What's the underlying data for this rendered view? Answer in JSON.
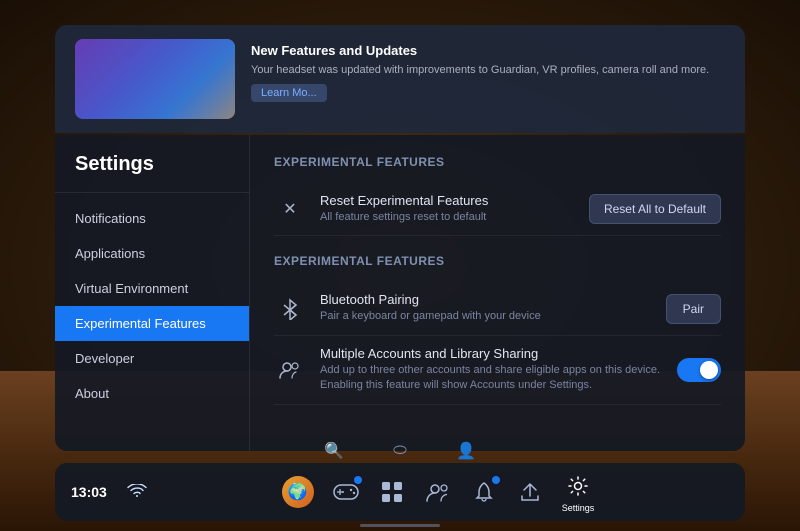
{
  "background": {
    "color_top": "#3a2a1a",
    "color_floor": "#4a2a10"
  },
  "notification": {
    "title": "New Features and Updates",
    "description": "Your headset was updated with improvements to Guardian, VR profiles, camera roll and more.",
    "link_label": "Learn Mo..."
  },
  "sidebar": {
    "title": "Settings",
    "items": [
      {
        "id": "notifications",
        "label": "Notifications",
        "active": false
      },
      {
        "id": "applications",
        "label": "Applications",
        "active": false
      },
      {
        "id": "virtual-environment",
        "label": "Virtual Environment",
        "active": false
      },
      {
        "id": "experimental-features",
        "label": "Experimental Features",
        "active": true
      },
      {
        "id": "developer",
        "label": "Developer",
        "active": false
      },
      {
        "id": "about",
        "label": "About",
        "active": false
      }
    ]
  },
  "main": {
    "sections": [
      {
        "id": "reset-section",
        "title": "Experimental Features",
        "rows": [
          {
            "id": "reset-experimental",
            "icon": "✕",
            "name": "Reset Experimental Features",
            "description": "All feature settings reset to default",
            "action_type": "button",
            "action_label": "Reset All to Default"
          }
        ]
      },
      {
        "id": "features-section",
        "title": "Experimental Features",
        "rows": [
          {
            "id": "bluetooth-pairing",
            "icon": "⚡",
            "name": "Bluetooth Pairing",
            "description": "Pair a keyboard or gamepad with your device",
            "action_type": "button",
            "action_label": "Pair"
          },
          {
            "id": "multiple-accounts",
            "icon": "👤",
            "name": "Multiple Accounts and Library Sharing",
            "description": "Add up to three other accounts and share eligible apps on this device. Enabling this feature will show Accounts under Settings.",
            "action_type": "toggle",
            "toggle_on": true
          }
        ]
      }
    ]
  },
  "taskbar": {
    "time": "13:03",
    "wifi_icon": "wifi",
    "items": [
      {
        "id": "avatar",
        "type": "avatar",
        "label": ""
      },
      {
        "id": "controller",
        "type": "icon",
        "symbol": "⬜",
        "label": "",
        "badge": true
      },
      {
        "id": "grid",
        "type": "icon",
        "symbol": "⊞",
        "label": ""
      },
      {
        "id": "social",
        "type": "icon",
        "symbol": "👥",
        "label": ""
      },
      {
        "id": "notifications",
        "type": "icon",
        "symbol": "🔔",
        "label": "",
        "badge": true
      },
      {
        "id": "share",
        "type": "icon",
        "symbol": "↗",
        "label": ""
      },
      {
        "id": "settings",
        "type": "icon",
        "symbol": "⚙",
        "label": "Settings",
        "active": true
      }
    ],
    "bottom_icons": [
      {
        "id": "search",
        "symbol": "🔍"
      },
      {
        "id": "vr-mode",
        "symbol": "⬭"
      },
      {
        "id": "person",
        "symbol": "👤"
      }
    ]
  }
}
